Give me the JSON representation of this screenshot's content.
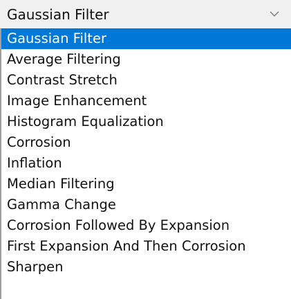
{
  "combo": {
    "value": "Gaussian Filter",
    "chevron_icon": "chevron-down-icon"
  },
  "list": {
    "selected_index": 0,
    "items": [
      {
        "label": "Gaussian Filter"
      },
      {
        "label": "Average Filtering"
      },
      {
        "label": "Contrast Stretch"
      },
      {
        "label": "Image Enhancement"
      },
      {
        "label": "Histogram Equalization"
      },
      {
        "label": "Corrosion"
      },
      {
        "label": "Inflation"
      },
      {
        "label": "Median Filtering"
      },
      {
        "label": "Gamma Change"
      },
      {
        "label": "Corrosion Followed By Expansion"
      },
      {
        "label": "First Expansion And Then Corrosion"
      },
      {
        "label": "Sharpen"
      }
    ]
  },
  "colors": {
    "combo_background": "#f0f0f0",
    "selection_background": "#0078d7",
    "selection_text": "#ffffff",
    "text": "#111111",
    "list_border": "#a0a0a0"
  }
}
